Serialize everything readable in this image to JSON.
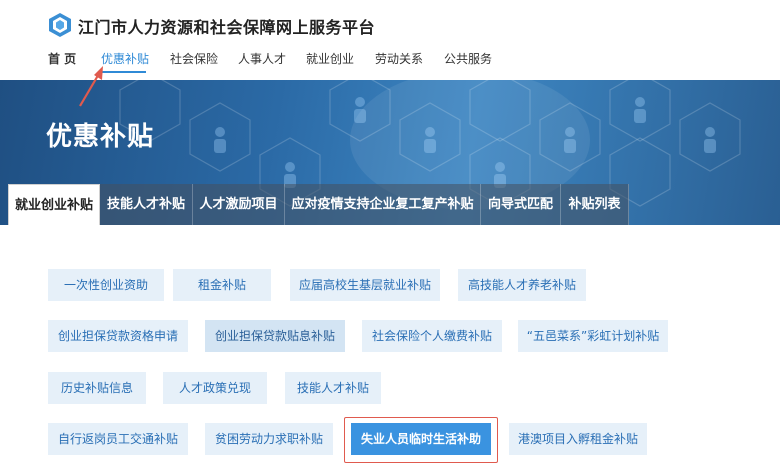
{
  "header": {
    "site_title": "江门市人力资源和社会保障网上服务平台",
    "logo_icon": "hexagon-logo-icon"
  },
  "nav": {
    "items": [
      {
        "label": "首  页"
      },
      {
        "label": "优惠补贴",
        "active": true
      },
      {
        "label": "社会保险"
      },
      {
        "label": "人事人才"
      },
      {
        "label": "就业创业"
      },
      {
        "label": "劳动关系"
      },
      {
        "label": "公共服务"
      }
    ]
  },
  "banner": {
    "title": "优惠补贴"
  },
  "tabs": [
    {
      "label": "就业创业补贴",
      "active": true
    },
    {
      "label": "技能人才补贴"
    },
    {
      "label": "人才激励项目"
    },
    {
      "label": "应对疫情支持企业复工复产补贴"
    },
    {
      "label": "向导式匹配"
    },
    {
      "label": "补贴列表"
    }
  ],
  "subsidies": [
    [
      "一次性创业资助",
      "租金补贴",
      "应届高校生基层就业补贴",
      "高技能人才养老补贴"
    ],
    [
      "创业担保贷款资格申请",
      "创业担保贷款贴息补贴",
      "社会保险个人缴费补贴",
      "“五邑菜系”彩虹计划补贴"
    ],
    [
      "历史补贴信息",
      "人才政策兑现",
      "技能人才补贴"
    ],
    [
      "自行返岗员工交通补贴",
      "贫困劳动力求职补贴",
      "失业人员临时生活补助",
      "港澳项目入孵租金补贴"
    ]
  ],
  "colors": {
    "accent": "#2f8ad6",
    "button_bg": "#e6f0f9",
    "button_text": "#2a6fb5",
    "selected_bg": "#3a93e0",
    "annotation_red": "#e05a4e"
  }
}
